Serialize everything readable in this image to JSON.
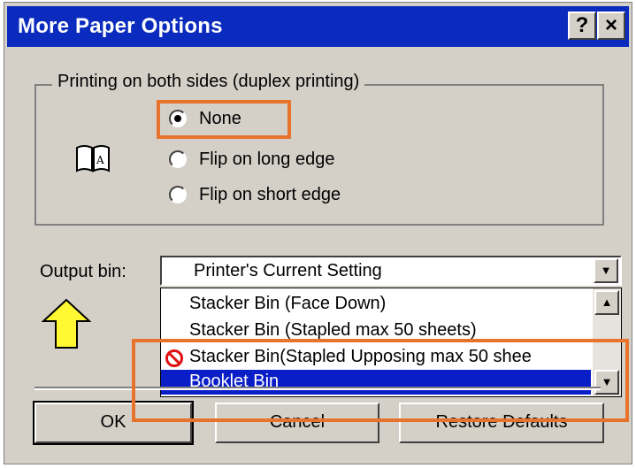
{
  "window": {
    "title": "More Paper Options",
    "help_label": "?",
    "close_label": "×"
  },
  "duplex": {
    "group_label": "Printing on both sides (duplex printing)",
    "options": [
      {
        "label": "None",
        "selected": true
      },
      {
        "label": "Flip on long edge",
        "selected": false
      },
      {
        "label": "Flip on short edge",
        "selected": false
      }
    ]
  },
  "output_bin": {
    "label": "Output bin:",
    "current_value": "Printer's Current Setting",
    "options": [
      {
        "label": "Stacker Bin (Face Down)",
        "selected": false
      },
      {
        "label": "Stacker Bin (Stapled max 50 sheets)",
        "selected": false
      },
      {
        "label": "Stacker Bin(Stapled Upposing max 50 shee",
        "selected": false,
        "unavailable": true
      },
      {
        "label": "Booklet Bin",
        "selected": true
      }
    ]
  },
  "buttons": {
    "ok": "OK",
    "cancel": "Cancel",
    "restore": "Restore Defaults"
  },
  "colors": {
    "highlight_box": "#e8732d",
    "arrow_fill": "#fff833",
    "title_bar": "#0a2bbe",
    "selection": "#0a1ec8"
  }
}
